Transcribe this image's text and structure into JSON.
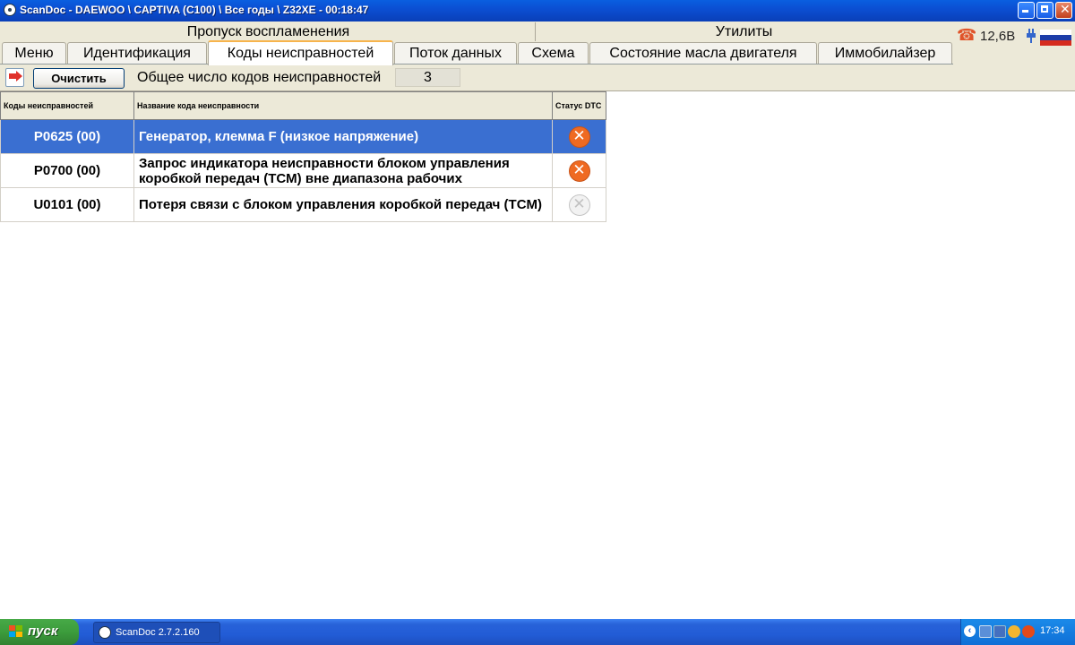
{
  "window": {
    "title": "ScanDoc - DAEWOO \\ CAPTIVA (C100) \\ Все годы \\ Z32XE - 00:18:47"
  },
  "groups": {
    "misfire": "Пропуск воспламенения",
    "utilities": "Утилиты"
  },
  "tabs": [
    {
      "label": "Меню"
    },
    {
      "label": "Идентификация"
    },
    {
      "label": "Коды неисправностей"
    },
    {
      "label": "Поток данных"
    },
    {
      "label": "Схема"
    },
    {
      "label": "Состояние масла двигателя"
    },
    {
      "label": "Иммобилайзер"
    }
  ],
  "active_tab": "Коды неисправностей",
  "status": {
    "voltage": "12,6В",
    "phone_icon": "phone-icon",
    "plug_icon": "plug-icon",
    "flag_icon": "russian-flag-icon"
  },
  "toolbar": {
    "clear_label": "Очистить",
    "count_label": "Общее число кодов неисправностей",
    "count_value": "3"
  },
  "table": {
    "headers": {
      "code": "Коды неисправностей",
      "name": "Название кода неисправности",
      "status": "Статус DTC"
    },
    "rows": [
      {
        "code": "P0625 (00)",
        "name": "Генератор, клемма F (низкое напряжение)",
        "status": "active",
        "selected": true
      },
      {
        "code": "P0700 (00)",
        "name": "Запрос индикатора неисправности блоком управления коробкой передач (TCM) вне диапазона рабочих",
        "status": "active",
        "selected": false
      },
      {
        "code": "U0101 (00)",
        "name": "Потеря связи с блоком управления коробкой передач (TCM)",
        "status": "inactive",
        "selected": false
      }
    ]
  },
  "taskbar": {
    "start_label": "пуск",
    "task_label": "ScanDoc 2.7.2.160",
    "clock": "17:34"
  },
  "colors": {
    "selection": "#3a6fd1",
    "status_active": "#ef6a22",
    "tab_accent": "#f7b44c"
  }
}
